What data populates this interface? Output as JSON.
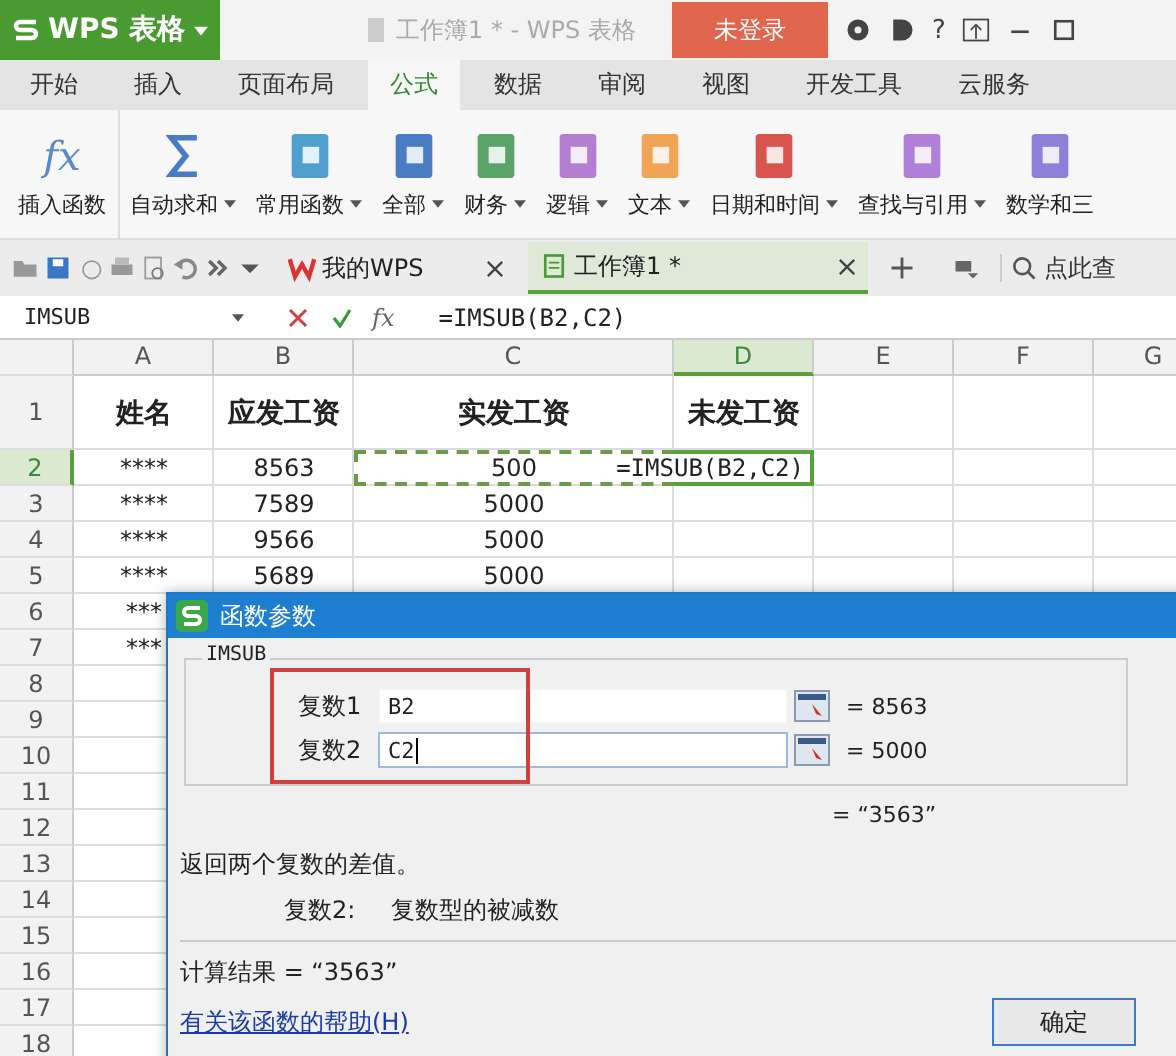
{
  "app": {
    "logo": "WPS 表格",
    "title": "工作簿1 * - WPS 表格",
    "login_button": "未登录",
    "help": "?"
  },
  "tabs": [
    {
      "label": "开始",
      "selected": false
    },
    {
      "label": "插入",
      "selected": false
    },
    {
      "label": "页面布局",
      "selected": false
    },
    {
      "label": "公式",
      "selected": true
    },
    {
      "label": "数据",
      "selected": false
    },
    {
      "label": "审阅",
      "selected": false
    },
    {
      "label": "视图",
      "selected": false
    },
    {
      "label": "开发工具",
      "selected": false
    },
    {
      "label": "云服务",
      "selected": false
    }
  ],
  "ribbon": [
    {
      "label": "插入函数",
      "kind": "fx",
      "symbol": "fx",
      "dropdown": false
    },
    {
      "label": "自动求和",
      "kind": "sigma",
      "dropdown": true
    },
    {
      "label": "常用函数",
      "kind": "book",
      "color": "#4f9fcf",
      "dropdown": true
    },
    {
      "label": "全部",
      "kind": "book",
      "color": "#4a7cc4",
      "dropdown": true
    },
    {
      "label": "财务",
      "kind": "book",
      "color": "#5aa469",
      "dropdown": true
    },
    {
      "label": "逻辑",
      "kind": "book",
      "color": "#b47fd0",
      "dropdown": true
    },
    {
      "label": "文本",
      "kind": "book",
      "color": "#f0a455",
      "dropdown": true
    },
    {
      "label": "日期和时间",
      "kind": "book",
      "color": "#d9534f",
      "dropdown": true
    },
    {
      "label": "查找与引用",
      "kind": "book",
      "color": "#b07fd8",
      "dropdown": true
    },
    {
      "label": "数学和三",
      "kind": "book",
      "color": "#8f7fd8",
      "dropdown": false
    }
  ],
  "doc_tabs": [
    {
      "label": "我的WPS",
      "kind": "home",
      "selected": false
    },
    {
      "label": "工作簿1 *",
      "kind": "sheet",
      "selected": true
    }
  ],
  "search": {
    "placeholder": "点此查"
  },
  "formula_bar": {
    "name_box": "IMSUB",
    "fx": "fx",
    "formula": "=IMSUB(B2,C2)"
  },
  "sheet": {
    "columns": [
      {
        "label": "A",
        "selected": false
      },
      {
        "label": "B",
        "selected": false
      },
      {
        "label": "C",
        "selected": false
      },
      {
        "label": "D",
        "selected": true
      },
      {
        "label": "E",
        "selected": false
      },
      {
        "label": "F",
        "selected": false
      },
      {
        "label": "G",
        "selected": false
      }
    ],
    "rows": [
      {
        "num": "1",
        "kind": "header",
        "selected": false,
        "cells": [
          {
            "text": "姓名",
            "referenced": false
          },
          {
            "text": "应发工资",
            "referenced": false
          },
          {
            "text": "实发工资",
            "referenced": false
          },
          {
            "text": "未发工资",
            "referenced": false
          }
        ]
      },
      {
        "num": "2",
        "kind": "data",
        "selected": true,
        "cells": [
          {
            "text": "****",
            "referenced": false
          },
          {
            "text": "8563",
            "referenced": false
          },
          {
            "text": "500",
            "referenced": true
          },
          {
            "text": "=IMSUB(B2,C2)",
            "referenced": false
          }
        ]
      },
      {
        "num": "3",
        "kind": "data",
        "selected": false,
        "cells": [
          {
            "text": "****",
            "referenced": false
          },
          {
            "text": "7589",
            "referenced": false
          },
          {
            "text": "5000",
            "referenced": false
          }
        ]
      },
      {
        "num": "4",
        "kind": "data",
        "selected": false,
        "cells": [
          {
            "text": "****",
            "referenced": false
          },
          {
            "text": "9566",
            "referenced": false
          },
          {
            "text": "5000",
            "referenced": false
          }
        ]
      },
      {
        "num": "5",
        "kind": "data",
        "selected": false,
        "cells": [
          {
            "text": "****",
            "referenced": false
          },
          {
            "text": "5689",
            "referenced": false
          },
          {
            "text": "5000",
            "referenced": false
          }
        ]
      },
      {
        "num": "6",
        "kind": "data",
        "selected": false,
        "cells": [
          {
            "text": "***",
            "referenced": false
          }
        ]
      },
      {
        "num": "7",
        "kind": "data",
        "selected": false,
        "cells": [
          {
            "text": "***",
            "referenced": false
          }
        ]
      },
      {
        "num": "8",
        "kind": "data",
        "selected": false
      },
      {
        "num": "9",
        "kind": "data",
        "selected": false
      },
      {
        "num": "10",
        "kind": "data",
        "selected": false
      },
      {
        "num": "11",
        "kind": "data",
        "selected": false
      },
      {
        "num": "12",
        "kind": "data",
        "selected": false
      },
      {
        "num": "13",
        "kind": "data",
        "selected": false
      },
      {
        "num": "14",
        "kind": "data",
        "selected": false
      },
      {
        "num": "15",
        "kind": "data",
        "selected": false
      },
      {
        "num": "16",
        "kind": "data",
        "selected": false
      },
      {
        "num": "17",
        "kind": "data",
        "selected": false
      },
      {
        "num": "18",
        "kind": "data",
        "selected": false
      }
    ]
  },
  "dialog": {
    "title": "函数参数",
    "function_name": "IMSUB",
    "args": [
      {
        "label": "复数1",
        "value": "B2",
        "result": "= 8563",
        "focused": false
      },
      {
        "label": "复数2",
        "value": "C2",
        "result": "= 5000",
        "focused": true
      }
    ],
    "formula_result": "= “3563”",
    "description": "返回两个复数的差值。",
    "arg_help_label": "复数2:",
    "arg_help": "复数型的被减数",
    "calc_result": "计算结果 = “3563”",
    "help_link": "有关该函数的帮助(H)",
    "ok_button": "确定"
  }
}
